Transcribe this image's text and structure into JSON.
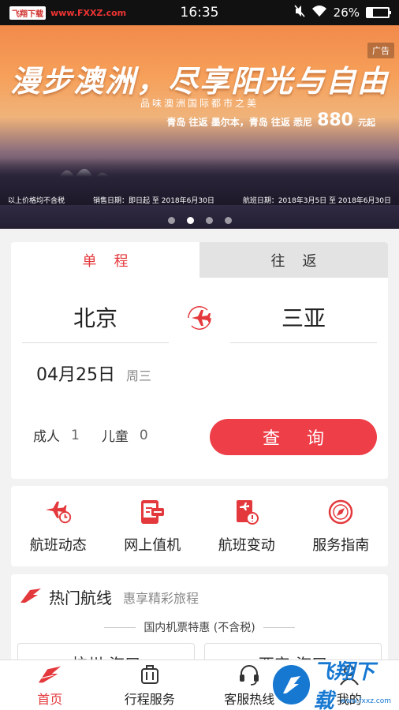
{
  "status_bar": {
    "badge": "飞翔下载",
    "url": "www.FXXZ.com",
    "time": "16:35",
    "battery": "26%",
    "battery_level": 0.26
  },
  "banner": {
    "ad_label": "广告",
    "title": "漫步澳洲，尽享阳光与自由",
    "subtitle": "品味澳洲国际都市之美",
    "promo": "青岛 往返 墨尔本，青岛 往返 悉尼",
    "price": "880",
    "price_unit": "元起",
    "note_tax": "以上价格均不含税",
    "note_sale": "销售日期：即日起 至 2018年6月30日",
    "note_flight": "航班日期：2018年3月5日 至 2018年6月30日",
    "dots_count": 4,
    "active_dot": 1
  },
  "booking": {
    "tab_oneway": "单程",
    "tab_roundtrip": "往返",
    "from_city": "北京",
    "to_city": "三亚",
    "date": "04月25日",
    "weekday": "周三",
    "adult_label": "成人",
    "adult_count": "1",
    "child_label": "儿童",
    "child_count": "0",
    "search_label": "查询"
  },
  "services": [
    {
      "label": "航班动态",
      "icon": "flight-status-icon"
    },
    {
      "label": "网上值机",
      "icon": "online-checkin-icon"
    },
    {
      "label": "航班变动",
      "icon": "flight-change-icon"
    },
    {
      "label": "服务指南",
      "icon": "compass-icon"
    }
  ],
  "routes": {
    "title": "热门航线",
    "subtitle": "惠享精彩旅程",
    "section": "国内机票特惠 (不含税)",
    "cards": [
      "杭州-海口",
      "西安-海口"
    ]
  },
  "bottom_nav": [
    {
      "label": "首页",
      "icon": "home-icon",
      "active": true
    },
    {
      "label": "行程服务",
      "icon": "luggage-icon",
      "active": false
    },
    {
      "label": "客服热线",
      "icon": "headset-icon",
      "active": false
    },
    {
      "label": "我的",
      "icon": "user-icon",
      "active": false
    }
  ],
  "watermark": {
    "text": "飞翔下载",
    "url": "www.fxxz.com"
  },
  "colors": {
    "brand_red": "#e4393c",
    "search_button": "#ee3e48",
    "watermark_blue": "#1778d2"
  }
}
